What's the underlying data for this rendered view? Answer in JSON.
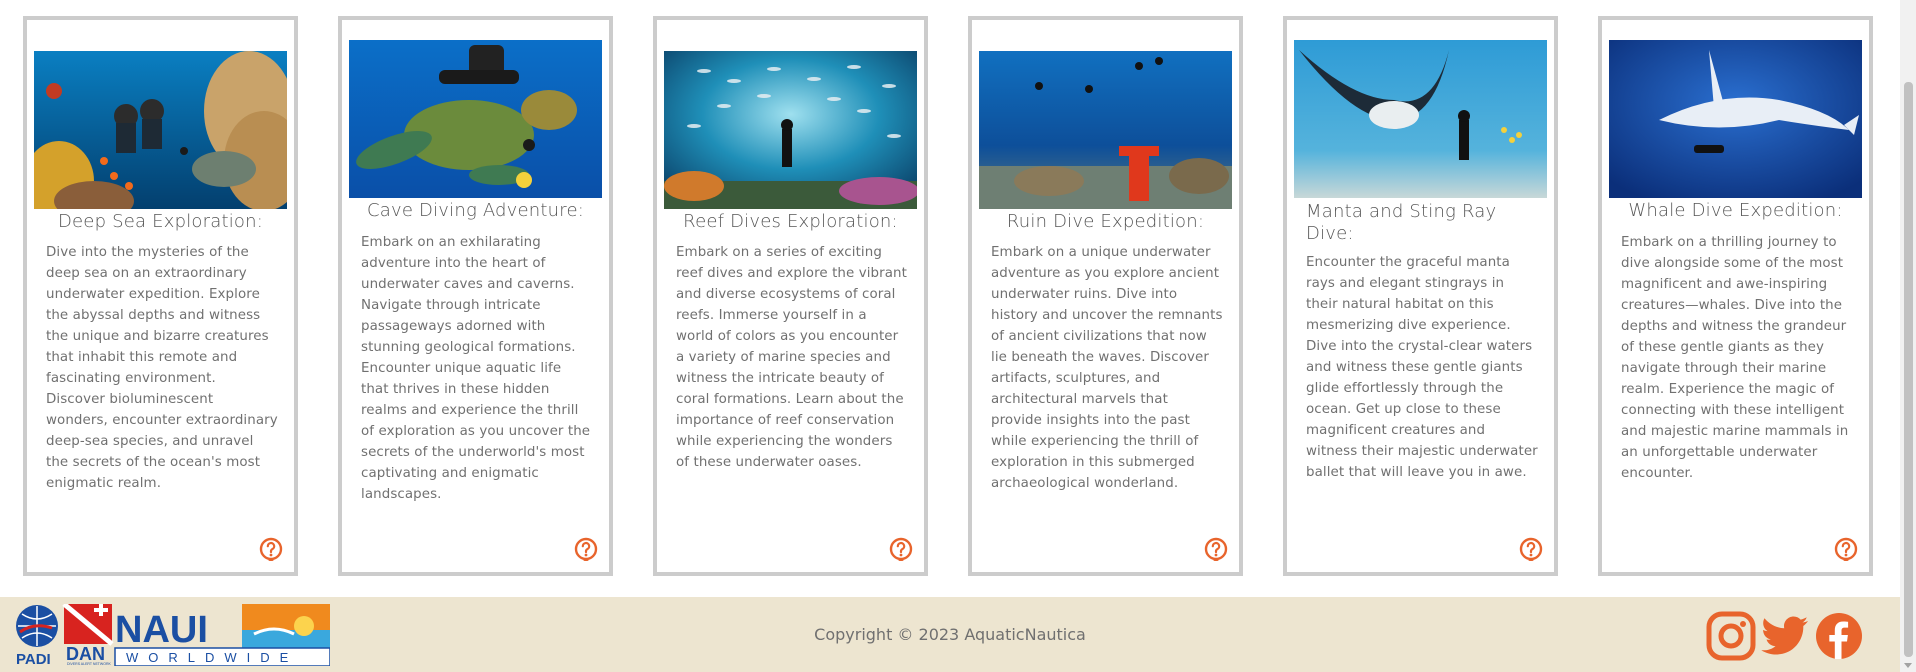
{
  "cards": [
    {
      "title": "Deep Sea Exploration:",
      "description": "Dive into the mysteries of the deep sea on an extraordinary underwater expedition. Explore the abyssal depths and witness the unique and bizarre creatures that inhabit this remote and fascinating environment. Discover bioluminescent wonders, encounter extraordinary deep-sea species, and unravel the secrets of the ocean's most enigmatic realm.",
      "icon": "help-icon"
    },
    {
      "title": "Cave Diving Adventure:",
      "description": "Embark on an exhilarating adventure into the heart of underwater caves and caverns. Navigate through intricate passageways adorned with stunning geological formations. Encounter unique aquatic life that thrives in these hidden realms and experience the thrill of exploration as you uncover the secrets of the underworld's most captivating and enigmatic landscapes.",
      "icon": "help-icon"
    },
    {
      "title": "Reef Dives Exploration:",
      "description": "Embark on a series of exciting reef dives and explore the vibrant and diverse ecosystems of coral reefs. Immerse yourself in a world of colors as you encounter a variety of marine species and witness the intricate beauty of coral formations. Learn about the importance of reef conservation while experiencing the wonders of these underwater oases.",
      "icon": "help-icon"
    },
    {
      "title": "Ruin Dive Expedition:",
      "description": "Embark on a unique underwater adventure as you explore ancient underwater ruins. Dive into history and uncover the remnants of ancient civilizations that now lie beneath the waves. Discover artifacts, sculptures, and architectural marvels that provide insights into the past while experiencing the thrill of exploration in this submerged archaeological wonderland.",
      "icon": "help-icon"
    },
    {
      "title": "Manta and Sting Ray Dive:",
      "description": "Encounter the graceful manta rays and elegant stingrays in their natural habitat on this mesmerizing dive experience. Dive into the crystal-clear waters and witness these gentle giants glide effortlessly through the ocean. Get up close to these magnificent creatures and witness their majestic underwater ballet that will leave you in awe.",
      "icon": "help-icon"
    },
    {
      "title": "Whale Dive Expedition:",
      "description": "Embark on a thrilling journey to dive alongside some of the most magnificent and awe-inspiring creatures—whales. Dive into the depths and witness the grandeur of these gentle giants as they navigate through their marine realm. Experience the magic of connecting with these intelligent and majestic marine mammals in an unforgettable underwater encounter.",
      "icon": "help-icon"
    }
  ],
  "footer": {
    "copyright": "Copyright © 2023 AquaticNautica",
    "logos": {
      "padi": "PADI",
      "dan": "DAN",
      "dan_sub": "DIVERS ALERT NETWORK",
      "naui": "NAUI",
      "naui_sub": "WORLDWIDE"
    },
    "social_icons": [
      "instagram-icon",
      "twitter-icon",
      "facebook-icon"
    ]
  },
  "colors": {
    "accent": "#e8642c",
    "card_border": "#cccccc",
    "footer_bg": "#ede5d0",
    "text": "#707070"
  }
}
